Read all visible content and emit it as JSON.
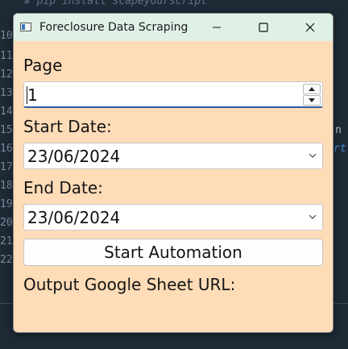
{
  "background_editor": {
    "line_numbers": [
      "10",
      "11",
      "12",
      "13",
      "14",
      "15",
      "16",
      "17",
      "18",
      "19",
      "20",
      "21",
      "22"
    ],
    "fragments": [
      "# pip install scapeyourscript",
      "n",
      "rt"
    ]
  },
  "window": {
    "title": "Foreclosure Data Scraping",
    "icons": {
      "app": "app-window-icon",
      "minimize": "minimize-icon",
      "maximize": "maximize-icon",
      "close": "close-icon"
    }
  },
  "form": {
    "page_label": "Page",
    "page_value": "1",
    "start_date_label": "Start Date:",
    "start_date_value": "23/06/2024",
    "end_date_label": "End Date:",
    "end_date_value": "23/06/2024",
    "start_button_label": "Start Automation",
    "output_label": "Output Google Sheet URL:"
  },
  "colors": {
    "window_background": "#ffdcb8",
    "titlebar_background": "#dff0e7",
    "focus_underline": "#2b5f9e"
  }
}
